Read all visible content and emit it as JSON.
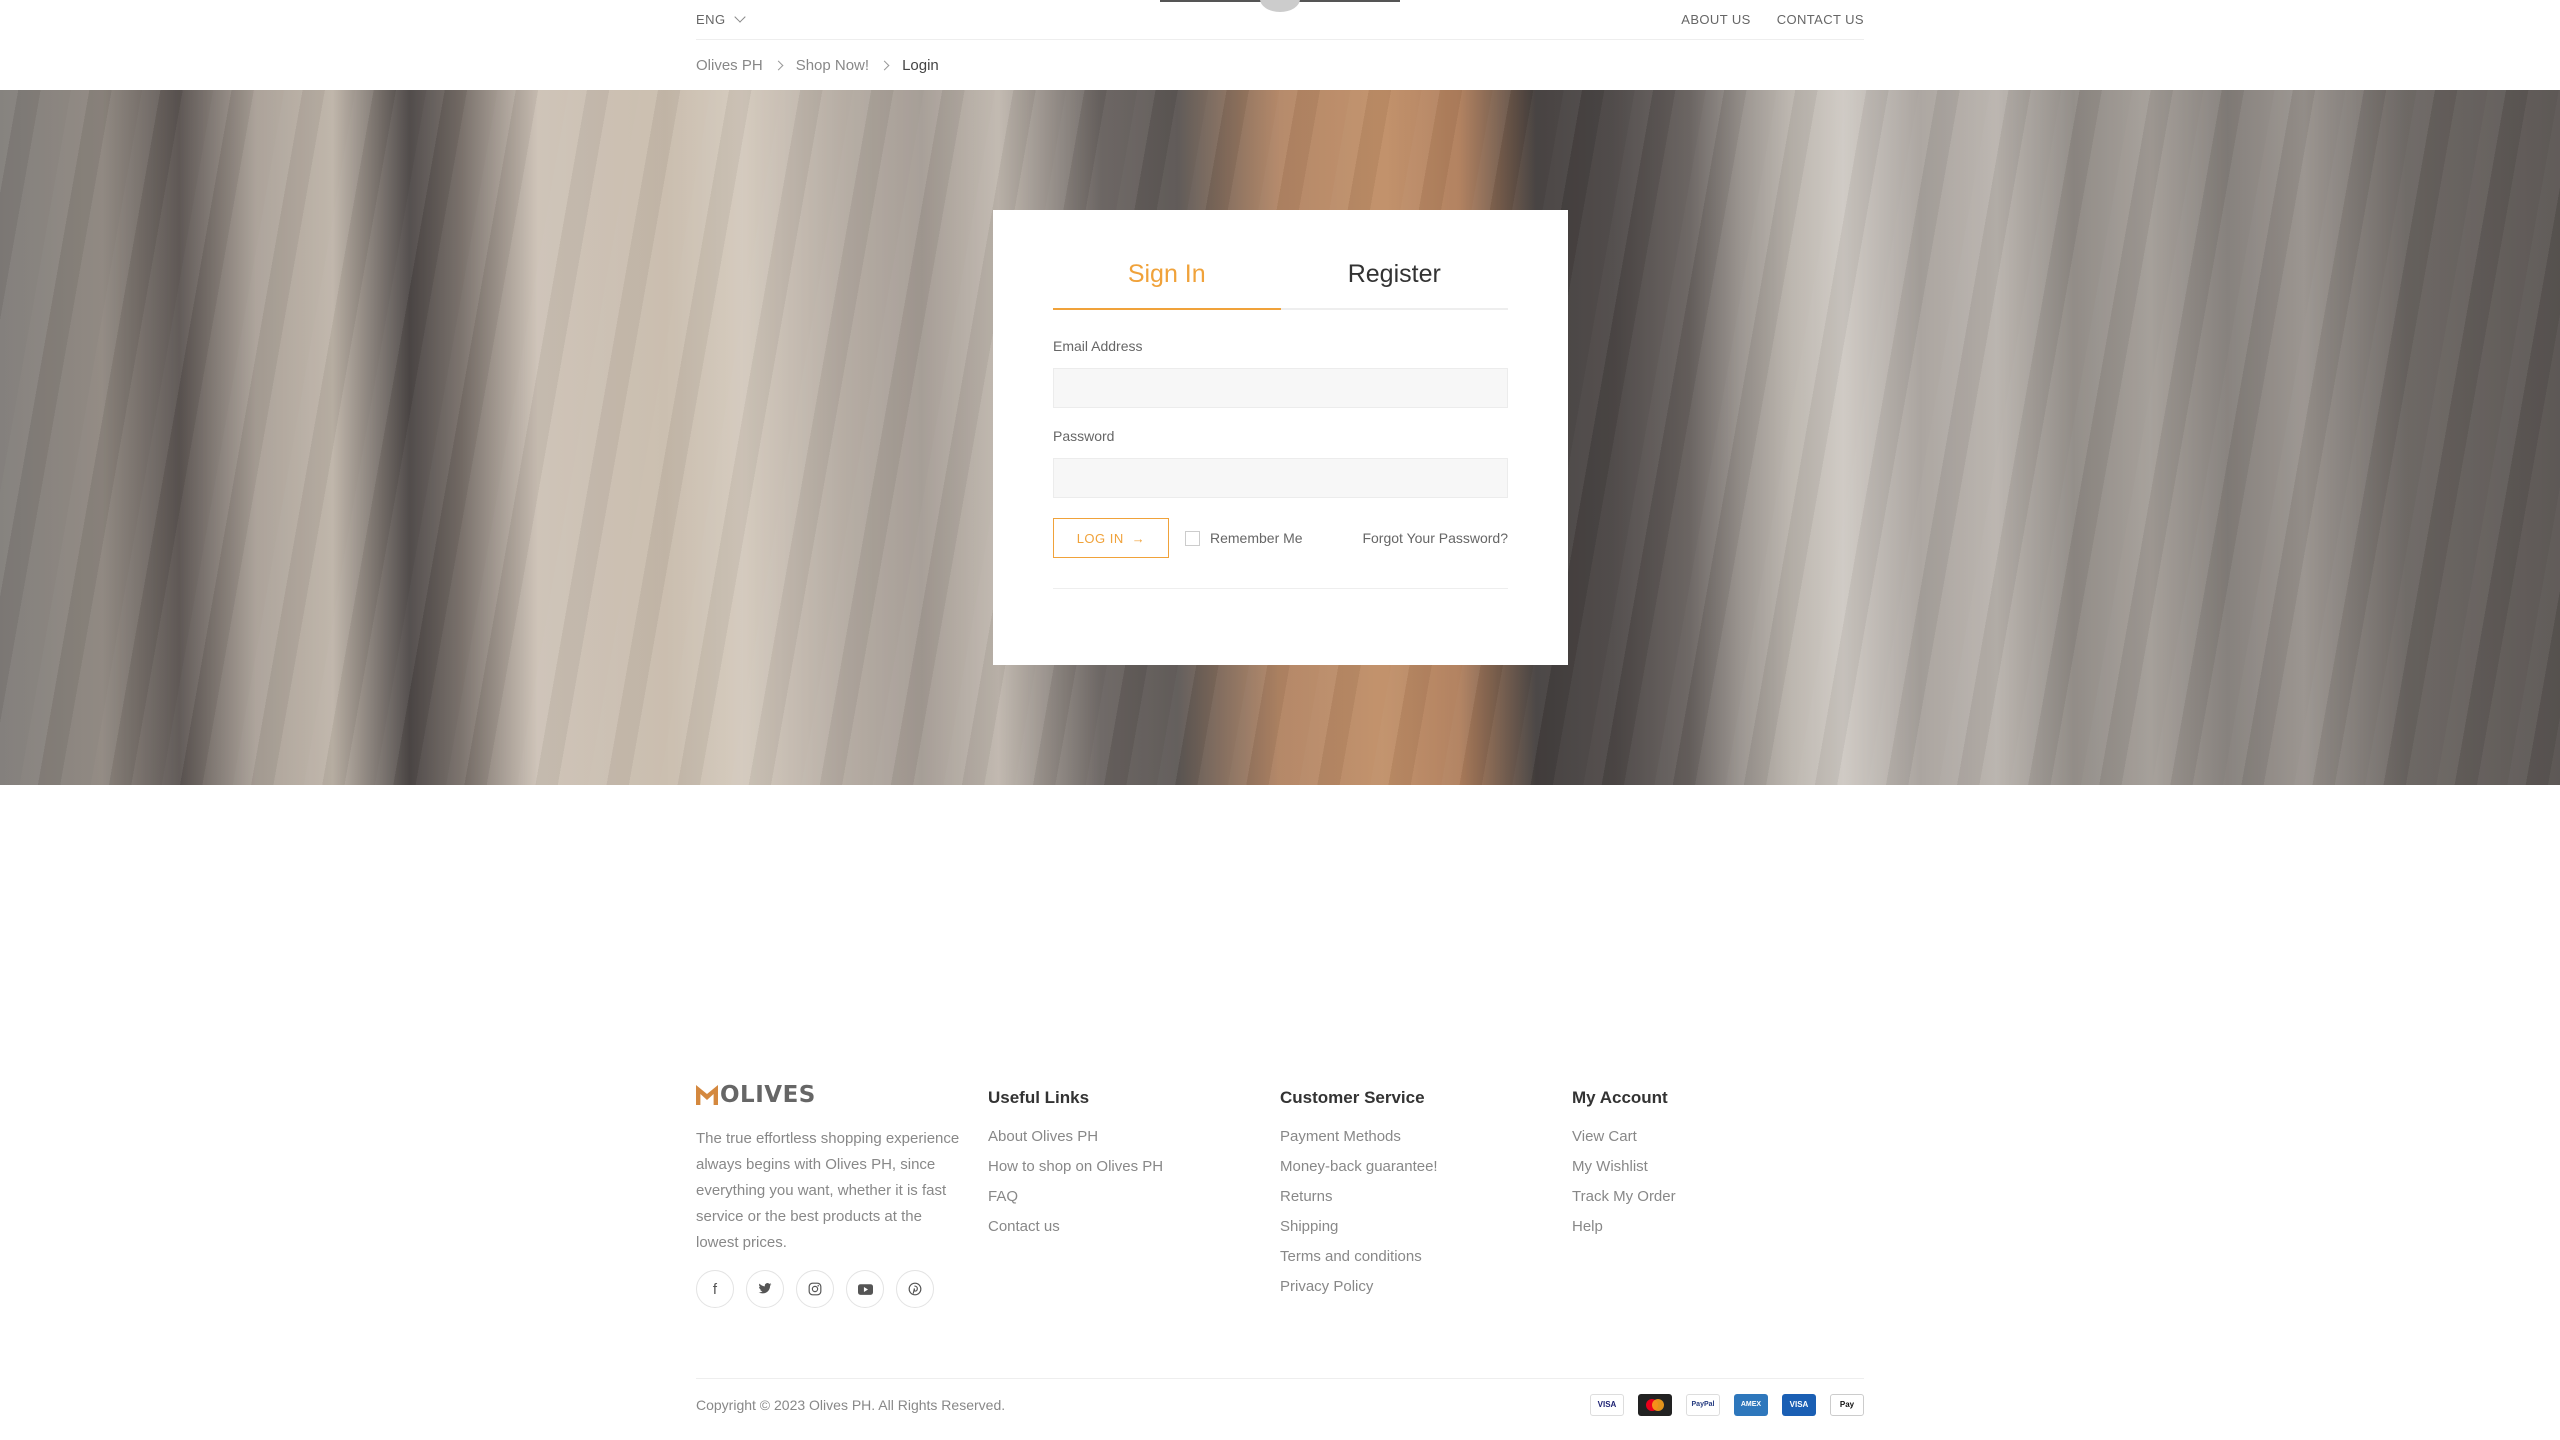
{
  "topbar": {
    "language": "ENG",
    "links": [
      "ABOUT US",
      "CONTACT US"
    ]
  },
  "breadcrumb": {
    "items": [
      "Olives PH",
      "Shop Now!",
      "Login"
    ]
  },
  "login": {
    "tabs": [
      "Sign In",
      "Register"
    ],
    "email_label": "Email Address",
    "password_label": "Password",
    "login_button": "LOG IN",
    "remember_label": "Remember Me",
    "forgot_label": "Forgot Your Password?"
  },
  "footer": {
    "brand": "OLIVES",
    "about": "The true effortless shopping experience always begins with Olives PH, since everything you want, whether it is fast service or the best products at the lowest prices.",
    "social_icons": [
      "facebook-icon",
      "twitter-icon",
      "instagram-icon",
      "youtube-icon",
      "pinterest-icon"
    ],
    "useful_links": {
      "title": "Useful Links",
      "items": [
        "About Olives PH",
        "How to shop on Olives PH",
        "FAQ",
        "Contact us"
      ]
    },
    "customer_service": {
      "title": "Customer Service",
      "items": [
        "Payment Methods",
        "Money-back guarantee!",
        "Returns",
        "Shipping",
        "Terms and conditions",
        "Privacy Policy"
      ]
    },
    "my_account": {
      "title": "My Account",
      "items": [
        "View Cart",
        "My Wishlist",
        "Track My Order",
        "Help"
      ]
    },
    "copyright": "Copyright © 2023 Olives PH. All Rights Reserved.",
    "payment_icons": [
      "visa-icon",
      "mastercard-icon",
      "paypal-icon",
      "amex-icon",
      "visa-blue-icon",
      "apple-pay-icon"
    ],
    "payment_labels": [
      "VISA",
      "",
      "PayPal",
      "AMEX",
      "VISA",
      "Pay"
    ]
  },
  "colors": {
    "accent": "#f0a23a",
    "brand_mark": "#d4883e"
  }
}
